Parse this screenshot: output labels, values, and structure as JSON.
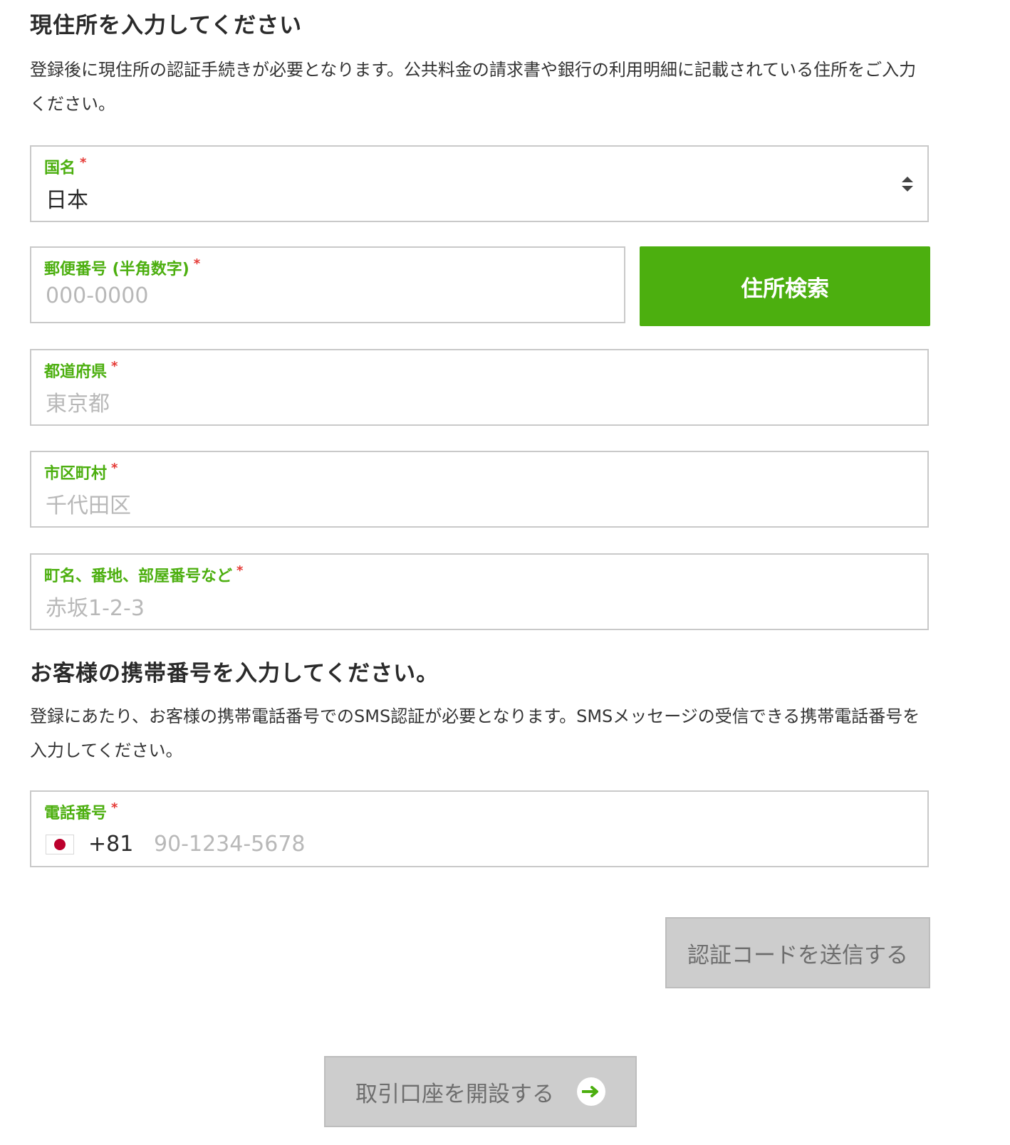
{
  "address_section": {
    "title": "現住所を入力してください",
    "description": "登録後に現住所の認証手続きが必要となります。公共料金の請求書や銀行の利用明細に記載されている住所をご入力ください。",
    "country": {
      "label": "国名",
      "required_mark": "*",
      "value": "日本"
    },
    "postal": {
      "label": "郵便番号 (半角数字)",
      "required_mark": "*",
      "placeholder": "000-0000"
    },
    "search_button": "住所検索",
    "prefecture": {
      "label": "都道府県",
      "required_mark": "*",
      "placeholder": "東京都"
    },
    "city": {
      "label": "市区町村",
      "required_mark": "*",
      "placeholder": "千代田区"
    },
    "street": {
      "label": "町名、番地、部屋番号など",
      "required_mark": "*",
      "placeholder": "赤坂1-2-3"
    }
  },
  "phone_section": {
    "title": "お客様の携帯番号を入力してください。",
    "description": "登録にあたり、お客様の携帯電話番号でのSMS認証が必要となります。SMSメッセージの受信できる携帯電話番号を入力してください。",
    "phone": {
      "label": "電話番号",
      "required_mark": "*",
      "dial_code": "+81",
      "placeholder": "90-1234-5678",
      "flag_icon": "japan-flag-icon"
    },
    "send_code_button": "認証コードを送信する"
  },
  "open_account_button": "取引口座を開設する",
  "colors": {
    "accent_green": "#4caf0f",
    "required_red": "#e53935",
    "disabled_gray": "#cdcdcd"
  }
}
